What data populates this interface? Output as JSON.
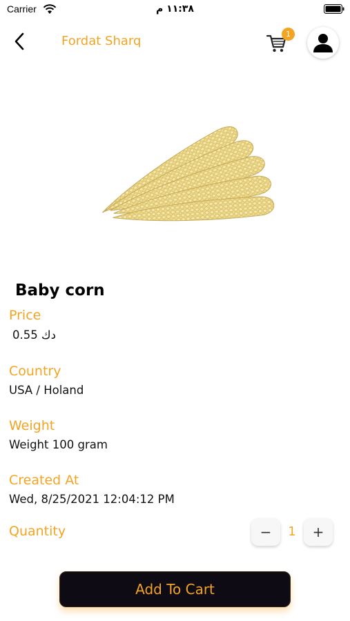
{
  "status_bar": {
    "carrier": "Carrier",
    "time": "١١:٣٨ م"
  },
  "header": {
    "store_name": "Fordat Sharq",
    "cart_count": "1"
  },
  "product": {
    "name": "Baby corn",
    "image_icon": "baby-corn-image"
  },
  "fields": [
    {
      "label": "Price",
      "value": "0.55 دك"
    },
    {
      "label": "Country",
      "value": "USA / Holand"
    },
    {
      "label": "Weight",
      "value": "Weight 100 gram"
    },
    {
      "label": "Created At",
      "value": "Wed, 8/25/2021 12:04:12 PM"
    }
  ],
  "quantity": {
    "label": "Quantity",
    "value": "1",
    "minus": "−",
    "plus": "+"
  },
  "actions": {
    "add_to_cart": "Add To Cart"
  },
  "colors": {
    "accent": "#f3a423",
    "button_bg": "#0e0b14",
    "text": "#000000"
  }
}
